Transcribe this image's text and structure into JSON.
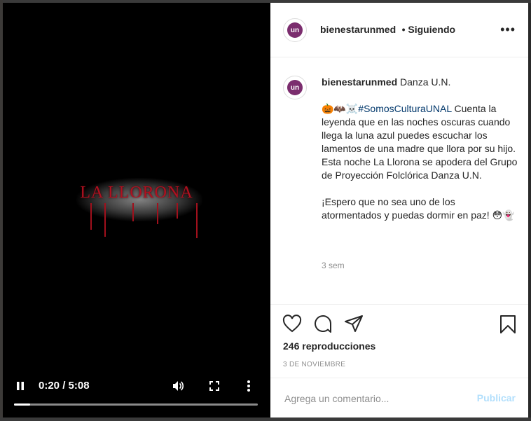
{
  "post": {
    "username": "bienestarunmed",
    "avatar_text": "un",
    "following_label": "• Siguiendo",
    "more_label": "•••"
  },
  "video": {
    "title_text": "LA LLORONA",
    "current_time": "0:20",
    "separator": "/",
    "duration": "5:08",
    "progress_fraction": 0.065
  },
  "caption": {
    "username": "bienestarunmed",
    "first_line": "Danza U.N.",
    "emojis": "🎃🦇☠️",
    "hashtag": "#SomosCulturaUNAL",
    "paragraph1": "Cuenta la leyenda que en las noches oscuras cuando llega la luna azul puedes escuchar los lamentos de una madre que llora por su hijo. Esta noche La Llorona se apodera del Grupo de Proyección Folclórica Danza U.N.",
    "paragraph2": "¡Espero que no sea uno de los atormentados y puedas dormir en paz!",
    "paragraph2_emojis": "😳👻",
    "time_ago": "3 sem"
  },
  "stats": {
    "views": "246 reproducciones",
    "date": "3 DE NOVIEMBRE"
  },
  "comment": {
    "placeholder": "Agrega un comentario...",
    "publish_label": "Publicar"
  },
  "colors": {
    "avatar": "#7b2d6e",
    "hashtag": "#00376b",
    "publish_disabled": "#b2dffc",
    "title_red": "#b01020"
  }
}
